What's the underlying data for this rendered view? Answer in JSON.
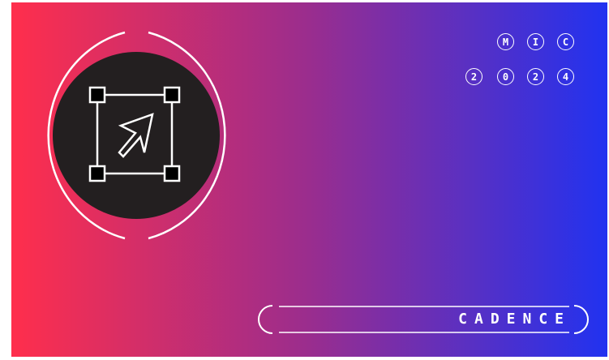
{
  "colors": {
    "gradient_start": "#ff2e4c",
    "gradient_mid": "#9a2d8e",
    "gradient_end": "#2132f0",
    "emblem_fill": "#231f20",
    "line": "#ffffff"
  },
  "emblem": {
    "icon": "selection-box-cursor-icon"
  },
  "badge": {
    "row1": [
      "M",
      "I",
      "C"
    ],
    "row2": [
      "2",
      "0",
      "2",
      "4"
    ]
  },
  "footer": {
    "label": "CADENCE"
  }
}
